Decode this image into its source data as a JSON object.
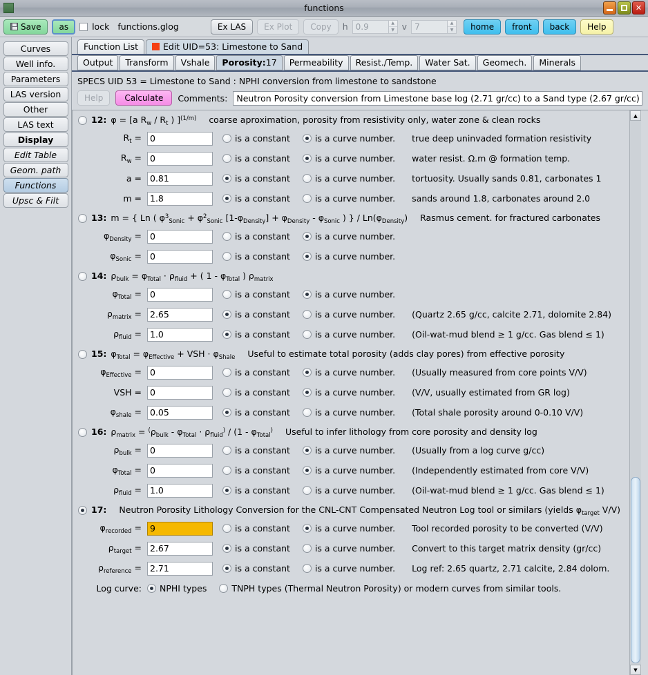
{
  "window": {
    "title": "functions",
    "buttons": {
      "minimize": "minimize-button",
      "maximize": "maximize-button",
      "close": "close-button"
    }
  },
  "toolbar": {
    "save_label": "Save",
    "as_label": "as",
    "lock_label": "lock",
    "filename": "functions.glog",
    "ex_las_label": "Ex LAS",
    "ex_plot_label": "Ex Plot",
    "copy_label": "Copy",
    "h_label": "h",
    "h_value": "0.9",
    "v_label": "v",
    "v_value": "7",
    "home_label": "home",
    "front_label": "front",
    "back_label": "back",
    "help_label": "Help"
  },
  "sidebar": {
    "items": [
      {
        "label": "Curves",
        "style": "normal",
        "active": false
      },
      {
        "label": "Well info.",
        "style": "normal",
        "active": false
      },
      {
        "label": "Parameters",
        "style": "normal",
        "active": false
      },
      {
        "label": "LAS version",
        "style": "normal",
        "active": false
      },
      {
        "label": "Other",
        "style": "normal",
        "active": false
      },
      {
        "label": "LAS text",
        "style": "normal",
        "active": false
      },
      {
        "label": "Display",
        "style": "bold",
        "active": false
      },
      {
        "label": "Edit Table",
        "style": "italic",
        "active": false
      },
      {
        "label": "Geom. path",
        "style": "italic",
        "active": false
      },
      {
        "label": "Functions",
        "style": "italic",
        "active": true
      },
      {
        "label": "Upsc & Filt",
        "style": "italic",
        "active": false
      }
    ]
  },
  "tabs_primary": [
    {
      "label": "Function List",
      "active": false,
      "has_marker": false
    },
    {
      "label": "Edit UID=53: Limestone to Sand",
      "active": true,
      "has_marker": true
    }
  ],
  "tabs_secondary": [
    {
      "label": "Output",
      "active": false
    },
    {
      "label": "Transform",
      "active": false
    },
    {
      "label": "Vshale",
      "active": false
    },
    {
      "label": "Porosity:17",
      "active": true,
      "bold_part": "Porosity:",
      "plain_part": "17"
    },
    {
      "label": "Permeability",
      "active": false
    },
    {
      "label": "Resist./Temp.",
      "active": false
    },
    {
      "label": "Water Sat.",
      "active": false
    },
    {
      "label": "Geomech.",
      "active": false
    },
    {
      "label": "Minerals",
      "active": false
    }
  ],
  "specs": {
    "line": "SPECS UID 53 = Limestone to Sand : NPHI conversion from limestone to sandstone",
    "help_label": "Help",
    "calculate_label": "Calculate",
    "comments_label": "Comments:",
    "comments_value": "Neutron Porosity conversion from Limestone base log (2.71 gr/cc) to a Sand type (2.67 gr/cc)"
  },
  "labels": {
    "is_constant": "is a constant",
    "is_curve": "is a curve number."
  },
  "blocks": [
    {
      "id": "12",
      "selected": false,
      "formula_html": "φ = [a R<sub>w</sub> / R<sub>t</sub> ) ]<sup>(1/m)</sup>",
      "description": "coarse aproximation, porosity from resistivity only, water zone & clean rocks",
      "rows": [
        {
          "name_html": "R<sub>t</sub> =",
          "value": "0",
          "mode": "curve",
          "hint": "true deep uninvaded formation resistivity"
        },
        {
          "name_html": "R<sub>w</sub> =",
          "value": "0",
          "mode": "curve",
          "hint": "water resist. Ω.m @ formation temp."
        },
        {
          "name_html": "a =",
          "value": "0.81",
          "mode": "constant",
          "hint": "tortuosity. Usually sands 0.81, carbonates 1"
        },
        {
          "name_html": "m =",
          "value": "1.8",
          "mode": "constant",
          "hint": "sands around 1.8, carbonates around 2.0"
        }
      ]
    },
    {
      "id": "13",
      "selected": false,
      "formula_html": "m = { Ln ( φ<sup>3</sup><sub>Sonic</sub> + φ<sup>2</sup><sub>Sonic</sub> [1-φ<sub>Density</sub>] + φ<sub>Density</sub> - φ<sub>Sonic</sub> ) } / Ln(φ<sub>Density</sub>)",
      "description": "Rasmus cement. for fractured carbonates",
      "rows": [
        {
          "name_html": "φ<sub>Density</sub> =",
          "value": "0",
          "mode": "curve",
          "hint": ""
        },
        {
          "name_html": "φ<sub>Sonic</sub> =",
          "value": "0",
          "mode": "curve",
          "hint": ""
        }
      ]
    },
    {
      "id": "14",
      "selected": false,
      "formula_html": "ρ<sub>bulk</sub> = φ<sub>Total</sub> · ρ<sub>fluid</sub> + ( 1 - φ<sub>Total</sub> ) ρ<sub>matrix</sub>",
      "description": "",
      "rows": [
        {
          "name_html": "φ<sub>Total</sub> =",
          "value": "0",
          "mode": "curve",
          "hint": ""
        },
        {
          "name_html": "ρ<sub>matrix</sub> =",
          "value": "2.65",
          "mode": "constant",
          "hint": "(Quartz 2.65 g/cc, calcite 2.71, dolomite 2.84)"
        },
        {
          "name_html": "ρ<sub>fluid</sub> =",
          "value": "1.0",
          "mode": "constant",
          "hint": "(Oil-wat-mud blend ≥ 1 g/cc. Gas blend ≤ 1)"
        }
      ]
    },
    {
      "id": "15",
      "selected": false,
      "formula_html": "φ<sub>Total</sub> = φ<sub>Effective</sub> + VSH · φ<sub>Shale</sub>",
      "description": "Useful to estimate total porosity (adds clay pores) from effective porosity",
      "rows": [
        {
          "name_html": "φ<sub>Effective</sub> =",
          "value": "0",
          "mode": "curve",
          "hint": "(Usually measured from core points V/V)"
        },
        {
          "name_html": "VSH =",
          "value": "0",
          "mode": "curve",
          "hint": "(V/V, usually estimated from GR log)"
        },
        {
          "name_html": "φ<sub>shale</sub> =",
          "value": "0.05",
          "mode": "constant",
          "hint": "(Total shale porosity around 0-0.10 V/V)"
        }
      ]
    },
    {
      "id": "16",
      "selected": false,
      "formula_html": "ρ<sub>matrix</sub> = <sup>(</sup>ρ<sub>bulk</sub> - φ<sub>Total</sub> · ρ<sub>fluid</sub><sup>)</sup> / (1 - φ<sub>Total</sub><sup>)</sup>",
      "description": "Useful to infer lithology from core porosity and density log",
      "rows": [
        {
          "name_html": "ρ<sub>bulk</sub> =",
          "value": "0",
          "mode": "curve",
          "hint": "(Usually from a log curve g/cc)"
        },
        {
          "name_html": "φ<sub>Total</sub> =",
          "value": "0",
          "mode": "curve",
          "hint": "(Independently estimated from core V/V)"
        },
        {
          "name_html": "ρ<sub>fluid</sub> =",
          "value": "1.0",
          "mode": "constant",
          "hint": "(Oil-wat-mud blend ≥ 1 g/cc. Gas blend ≤ 1)"
        }
      ]
    },
    {
      "id": "17",
      "selected": true,
      "formula_html": "",
      "description": "Neutron Porosity Lithology Conversion for the CNL-CNT Compensated Neutron Log tool or similars (yields φ<sub>target</sub> V/V)",
      "rows": [
        {
          "name_html": "φ<sub>recorded</sub> =",
          "value": "9",
          "mode": "curve",
          "hint": "Tool recorded porosity to be converted (V/V)",
          "highlight": true
        },
        {
          "name_html": "ρ<sub>target</sub> =",
          "value": "2.67",
          "mode": "constant",
          "hint": "Convert to this target matrix density (gr/cc)"
        },
        {
          "name_html": "ρ<sub>reference</sub> =",
          "value": "2.71",
          "mode": "constant",
          "hint": "Log ref: 2.65 quartz, 2.71 calcite, 2.84 dolom."
        }
      ],
      "log_curve": {
        "label": "Log curve:",
        "options": [
          {
            "label": "NPHI types",
            "selected": true
          },
          {
            "label": "TNPH types (Thermal Neutron Porosity) or modern curves from similar tools.",
            "selected": false
          }
        ]
      }
    }
  ],
  "colors": {
    "window_bg": "#d4d8dd",
    "accent_blue": "#40bfee",
    "save_green": "#84d79c",
    "calculate_pink": "#f58ce6",
    "help_yellow": "#f6f2a8",
    "highlight_amber": "#f5b800",
    "tab_marker_red": "#f43f14"
  }
}
